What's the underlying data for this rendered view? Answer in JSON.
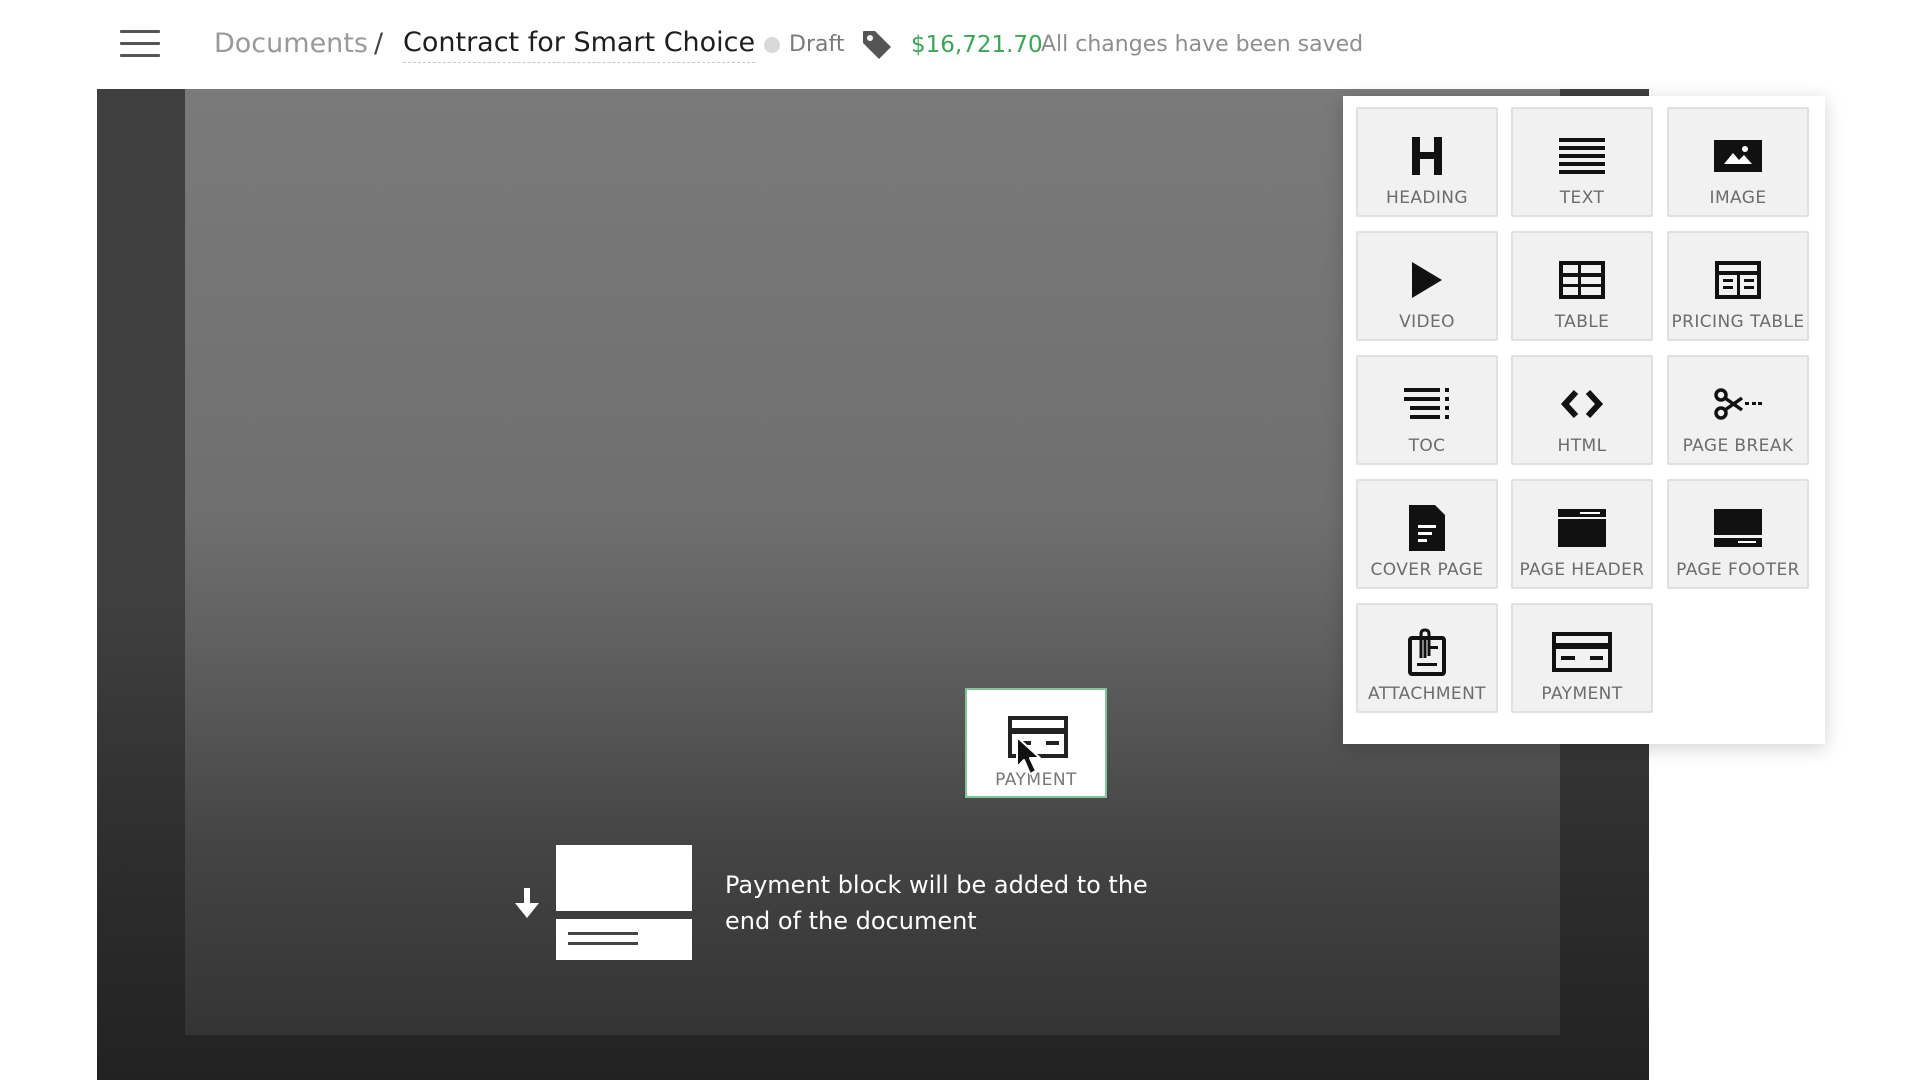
{
  "header": {
    "breadcrumb_root": "Documents",
    "separator": "/",
    "document_title": "Contract for Smart Choice",
    "status": "Draft",
    "price": "$16,721.70",
    "save_status": "All changes have been saved"
  },
  "canvas": {
    "drop_message": "Payment block will be added to the end of the document",
    "dragged_block_label": "PAYMENT"
  },
  "palette": {
    "blocks": [
      {
        "label": "HEADING",
        "icon": "heading-icon"
      },
      {
        "label": "TEXT",
        "icon": "text-icon"
      },
      {
        "label": "IMAGE",
        "icon": "image-icon"
      },
      {
        "label": "VIDEO",
        "icon": "video-icon"
      },
      {
        "label": "TABLE",
        "icon": "table-icon"
      },
      {
        "label": "PRICING TABLE",
        "icon": "pricing-table-icon"
      },
      {
        "label": "TOC",
        "icon": "toc-icon"
      },
      {
        "label": "HTML",
        "icon": "html-icon"
      },
      {
        "label": "PAGE BREAK",
        "icon": "scissors-icon"
      },
      {
        "label": "COVER PAGE",
        "icon": "cover-page-icon"
      },
      {
        "label": "PAGE HEADER",
        "icon": "page-header-icon"
      },
      {
        "label": "PAGE FOOTER",
        "icon": "page-footer-icon"
      },
      {
        "label": "ATTACHMENT",
        "icon": "attachment-icon"
      },
      {
        "label": "PAYMENT",
        "icon": "payment-icon"
      }
    ]
  },
  "colors": {
    "price_green": "#3aa655",
    "drag_border": "#7fc79a",
    "tile_bg": "#f1f1f1"
  }
}
